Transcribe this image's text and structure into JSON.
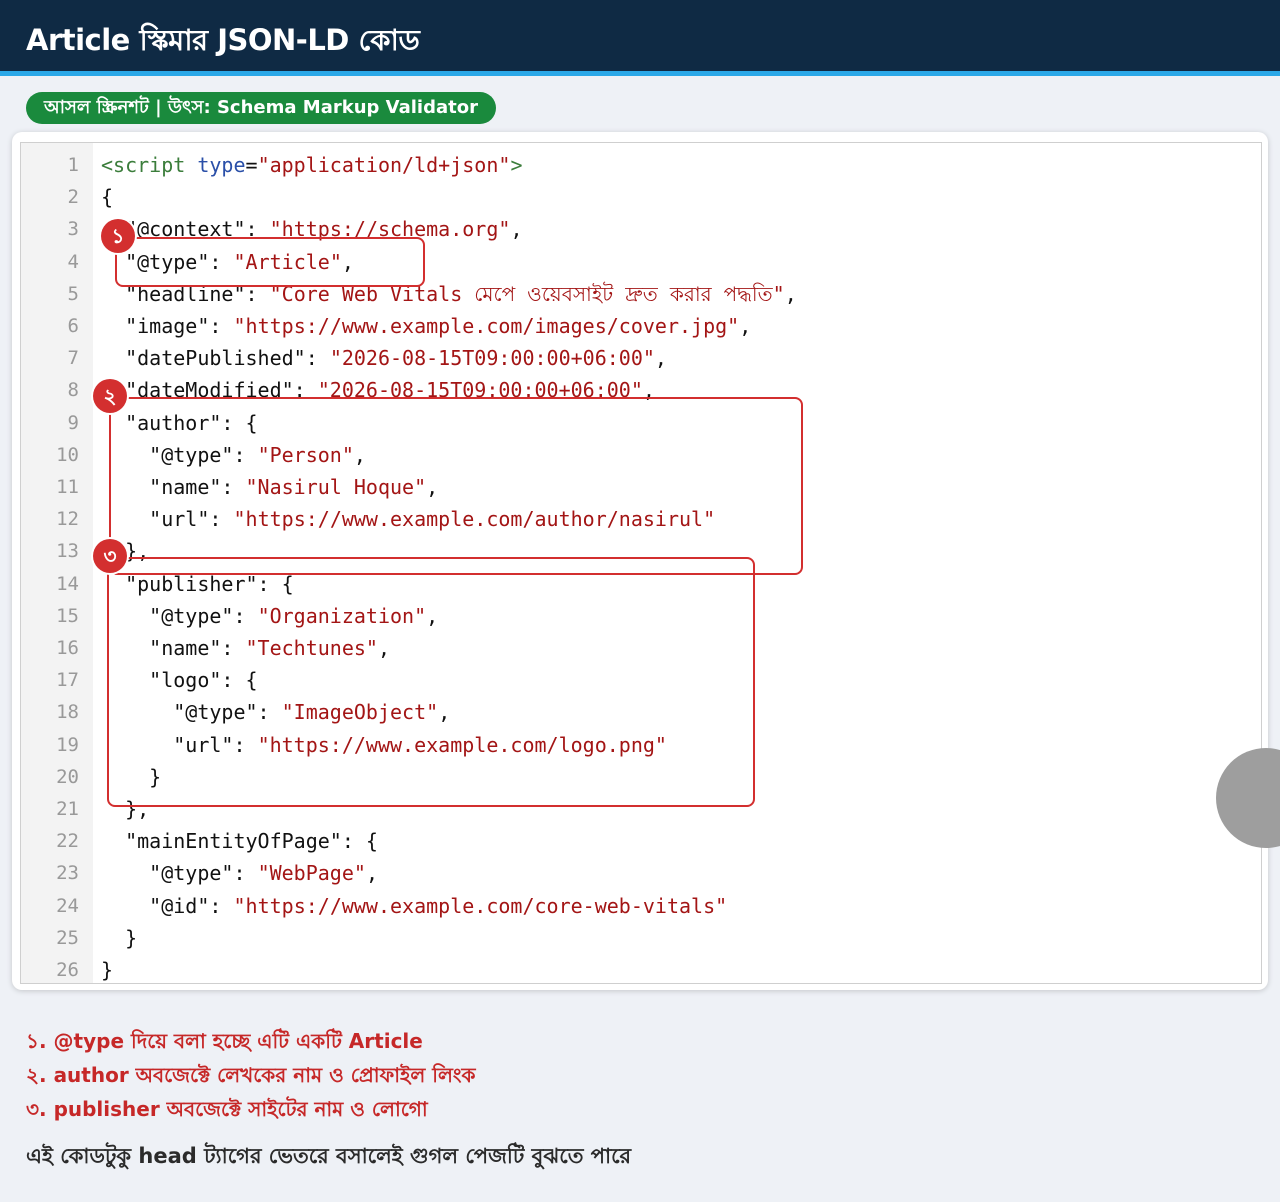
{
  "header": {
    "title": "Article স্কিমার JSON-LD কোড"
  },
  "badge": {
    "text": "আসল স্ক্রিনশট | উৎস: Schema Markup Validator"
  },
  "editor": {
    "lines": [
      {
        "n": "1",
        "t": "<script type=\"application/ld+json\">"
      },
      {
        "n": "2",
        "t": "{"
      },
      {
        "n": "3",
        "t": "  \"@context\": \"https://schema.org\","
      },
      {
        "n": "4",
        "t": "  \"@type\": \"Article\","
      },
      {
        "n": "5",
        "t": "  \"headline\": \"Core Web Vitals মেপে ওয়েবসাইট দ্রুত করার পদ্ধতি\","
      },
      {
        "n": "6",
        "t": "  \"image\": \"https://www.example.com/images/cover.jpg\","
      },
      {
        "n": "7",
        "t": "  \"datePublished\": \"2026-08-15T09:00:00+06:00\","
      },
      {
        "n": "8",
        "t": "  \"dateModified\": \"2026-08-15T09:00:00+06:00\","
      },
      {
        "n": "9",
        "t": "  \"author\": {"
      },
      {
        "n": "10",
        "t": "    \"@type\": \"Person\","
      },
      {
        "n": "11",
        "t": "    \"name\": \"Nasirul Hoque\","
      },
      {
        "n": "12",
        "t": "    \"url\": \"https://www.example.com/author/nasirul\""
      },
      {
        "n": "13",
        "t": "  },"
      },
      {
        "n": "14",
        "t": "  \"publisher\": {"
      },
      {
        "n": "15",
        "t": "    \"@type\": \"Organization\","
      },
      {
        "n": "16",
        "t": "    \"name\": \"Techtunes\","
      },
      {
        "n": "17",
        "t": "    \"logo\": {"
      },
      {
        "n": "18",
        "t": "      \"@type\": \"ImageObject\","
      },
      {
        "n": "19",
        "t": "      \"url\": \"https://www.example.com/logo.png\""
      },
      {
        "n": "20",
        "t": "    }"
      },
      {
        "n": "21",
        "t": "  },"
      },
      {
        "n": "22",
        "t": "  \"mainEntityOfPage\": {"
      },
      {
        "n": "23",
        "t": "    \"@type\": \"WebPage\","
      },
      {
        "n": "24",
        "t": "    \"@id\": \"https://www.example.com/core-web-vitals\""
      },
      {
        "n": "25",
        "t": "  }"
      },
      {
        "n": "26",
        "t": "}"
      }
    ]
  },
  "markers": [
    "১",
    "২",
    "৩"
  ],
  "notes": [
    "১. @type দিয়ে বলা হচ্ছে এটি একটি Article",
    "২. author অবজেক্টে লেখকের নাম ও প্রোফাইল লিংক",
    "৩. publisher অবজেক্টে সাইটের নাম ও লোগো"
  ],
  "summary": "এই কোডটুকু head ট্যাগের ভেতরে বসালেই গুগল পেজটি বুঝতে পারে",
  "colors": {
    "header_bg": "#0f2a44",
    "header_accent": "#2aa8e8",
    "badge_bg": "#1a8a3d",
    "highlight": "#d32f2f",
    "string": "#a31515",
    "tag": "#3b7d3b",
    "attr": "#2a4fa8"
  }
}
